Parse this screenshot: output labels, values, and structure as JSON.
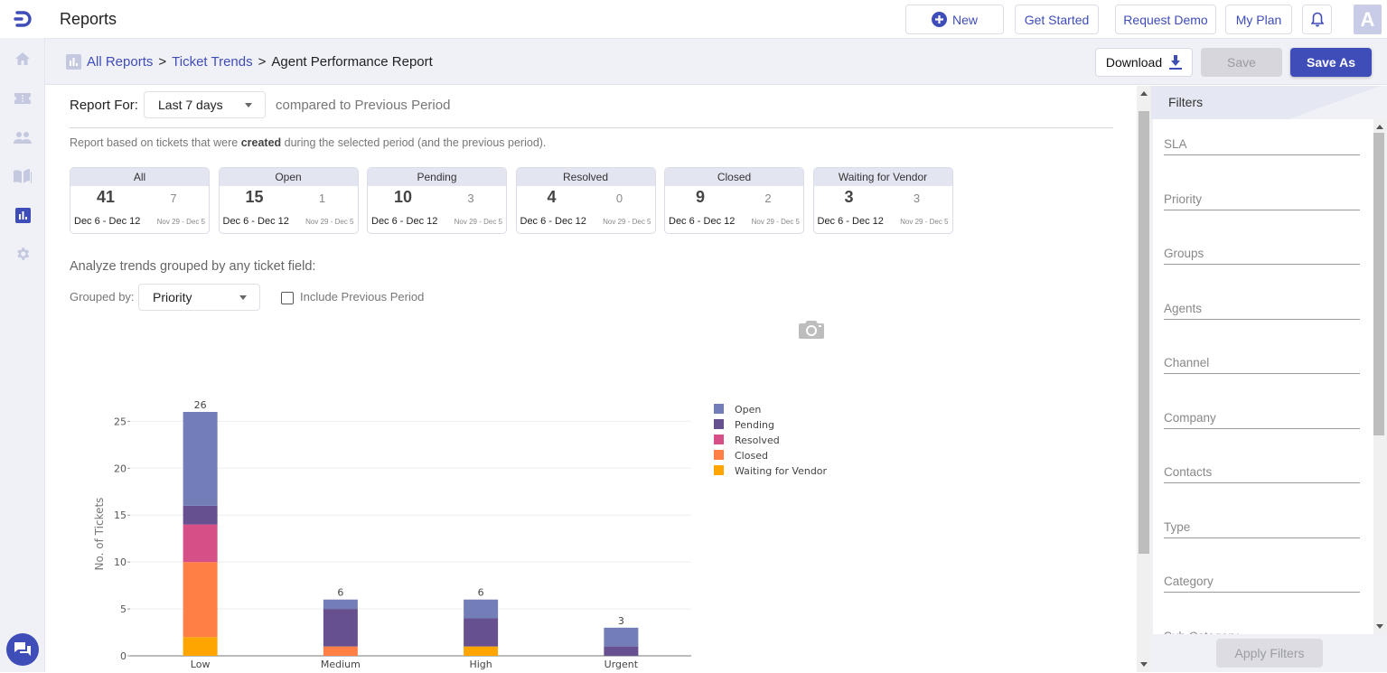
{
  "app": {
    "title": "Reports"
  },
  "topbar": {
    "new_label": "New",
    "get_started_label": "Get Started",
    "request_demo_label": "Request Demo",
    "my_plan_label": "My Plan",
    "avatar_initial": "A"
  },
  "breadcrumb": {
    "items": [
      "All Reports",
      "Ticket Trends",
      "Agent Performance Report"
    ],
    "separator": ">"
  },
  "actions": {
    "download_label": "Download",
    "save_label": "Save",
    "save_as_label": "Save As"
  },
  "sidebar": {
    "items": [
      {
        "name": "home",
        "icon": "home-icon"
      },
      {
        "name": "tickets",
        "icon": "ticket-icon"
      },
      {
        "name": "contacts",
        "icon": "users-icon"
      },
      {
        "name": "knowledge-base",
        "icon": "book-icon"
      },
      {
        "name": "reports",
        "icon": "bar-chart-icon",
        "active": true
      },
      {
        "name": "settings",
        "icon": "gear-icon"
      }
    ]
  },
  "report": {
    "report_for_label": "Report For:",
    "period_value": "Last 7 days",
    "compared_text": "compared to Previous Period",
    "note_prefix": "Report based on tickets that were ",
    "note_bold": "created",
    "note_suffix": " during the selected period (and the previous period).",
    "cards": [
      {
        "title": "All",
        "current": "41",
        "previous": "7",
        "current_range": "Dec 6 - Dec 12",
        "previous_range": "Nov 29 - Dec 5"
      },
      {
        "title": "Open",
        "current": "15",
        "previous": "1",
        "current_range": "Dec 6 - Dec 12",
        "previous_range": "Nov 29 - Dec 5"
      },
      {
        "title": "Pending",
        "current": "10",
        "previous": "3",
        "current_range": "Dec 6 - Dec 12",
        "previous_range": "Nov 29 - Dec 5"
      },
      {
        "title": "Resolved",
        "current": "4",
        "previous": "0",
        "current_range": "Dec 6 - Dec 12",
        "previous_range": "Nov 29 - Dec 5"
      },
      {
        "title": "Closed",
        "current": "9",
        "previous": "2",
        "current_range": "Dec 6 - Dec 12",
        "previous_range": "Nov 29 - Dec 5"
      },
      {
        "title": "Waiting for Vendor",
        "current": "3",
        "previous": "3",
        "current_range": "Dec 6 - Dec 12",
        "previous_range": "Nov 29 - Dec 5"
      }
    ],
    "analyze_text": "Analyze trends grouped by any ticket field:",
    "grouped_by_label": "Grouped by:",
    "grouped_by_value": "Priority",
    "include_previous_label": "Include Previous Period",
    "include_previous_checked": false
  },
  "chart_data": {
    "type": "bar",
    "stacked": true,
    "title": "",
    "xlabel": "",
    "ylabel": "No. of Tickets",
    "categories": [
      "Low",
      "Medium",
      "High",
      "Urgent"
    ],
    "ylim": [
      0,
      27
    ],
    "yticks": [
      0,
      5,
      10,
      15,
      20,
      25
    ],
    "grid": true,
    "legend_position": "right",
    "totals": [
      26,
      6,
      6,
      3
    ],
    "series": [
      {
        "name": "Waiting for Vendor",
        "color": "#ffa500",
        "values": [
          2,
          0,
          1,
          0
        ]
      },
      {
        "name": "Closed",
        "color": "#ff7f45",
        "values": [
          8,
          1,
          0,
          0
        ]
      },
      {
        "name": "Resolved",
        "color": "#d64f86",
        "values": [
          4,
          0,
          0,
          0
        ]
      },
      {
        "name": "Pending",
        "color": "#66508f",
        "values": [
          2,
          4,
          3,
          1
        ]
      },
      {
        "name": "Open",
        "color": "#737db8",
        "values": [
          10,
          1,
          2,
          2
        ]
      }
    ],
    "legend_order": [
      "Open",
      "Pending",
      "Resolved",
      "Closed",
      "Waiting for Vendor"
    ]
  },
  "filters": {
    "title": "Filters",
    "fields": [
      "SLA",
      "Priority",
      "Groups",
      "Agents",
      "Channel",
      "Company",
      "Contacts",
      "Type",
      "Category",
      "Sub Category"
    ],
    "apply_label": "Apply Filters"
  },
  "colors": {
    "brand": "#3f4db8",
    "sidebar_bg": "#f0f1f7"
  }
}
